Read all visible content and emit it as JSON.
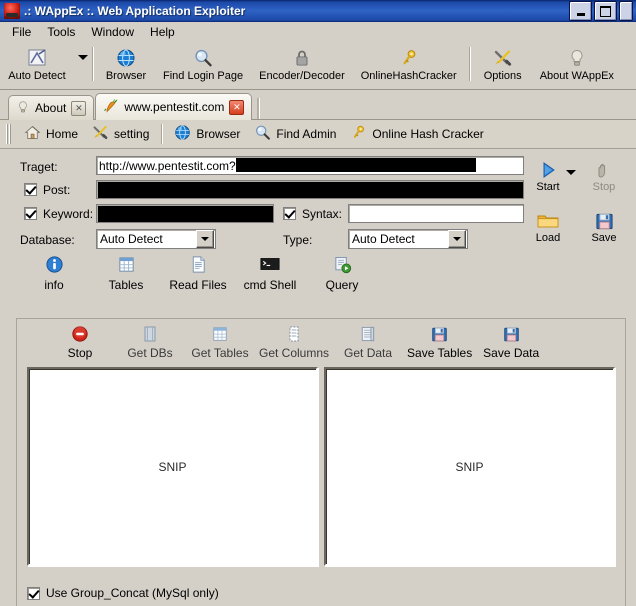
{
  "window": {
    "title": ".: WAppEx :.  Web Application Exploiter",
    "minimize_label": "_",
    "maximize_label": "",
    "close_label": ""
  },
  "menubar": {
    "items": [
      {
        "label": "File"
      },
      {
        "label": "Tools"
      },
      {
        "label": "Window"
      },
      {
        "label": "Help"
      }
    ]
  },
  "toolbar": {
    "items": [
      {
        "label": "Auto Detect",
        "icon": "auto-detect-icon",
        "has_dropdown": true
      },
      {
        "label": "Browser",
        "icon": "globe-icon"
      },
      {
        "label": "Find Login Page",
        "icon": "magnifier-icon"
      },
      {
        "label": "Encoder/Decoder",
        "icon": "padlock-icon"
      },
      {
        "label": "OnlineHashCracker",
        "icon": "key-icon"
      },
      {
        "label": "Options",
        "icon": "tools-icon"
      },
      {
        "label": "About WAppEx",
        "icon": "lightbulb-icon"
      }
    ]
  },
  "tabs": [
    {
      "label": "About",
      "icon": "lightbulb-icon",
      "close_label": "✕",
      "active": false
    },
    {
      "label": "www.pentestit.com",
      "icon": "carrot-icon",
      "close_label": "✕",
      "active": true
    }
  ],
  "navbar": {
    "items": [
      {
        "label": "Home",
        "icon": "home-icon"
      },
      {
        "label": "setting",
        "icon": "tools-icon"
      },
      {
        "label": "Browser",
        "icon": "globe-icon"
      },
      {
        "label": "Find Admin",
        "icon": "magnifier-icon"
      },
      {
        "label": "Online Hash Cracker",
        "icon": "key-icon"
      }
    ]
  },
  "form": {
    "target_label": "Traget:",
    "target_value": "http://www.pentestit.com?",
    "post_label": "Post:",
    "post_checked": true,
    "post_value": "",
    "keyword_label": "Keyword:",
    "keyword_checked": true,
    "keyword_value": "",
    "syntax_label": "Syntax:",
    "syntax_checked": true,
    "syntax_value": "",
    "database_label": "Database:",
    "database_value": "Auto Detect",
    "type_label": "Type:",
    "type_value": "Auto Detect"
  },
  "actions": {
    "start_label": "Start",
    "stop_label": "Stop",
    "load_label": "Load",
    "save_label": "Save",
    "stop_disabled": true
  },
  "modes": [
    {
      "label": "info",
      "icon": "info-icon"
    },
    {
      "label": "Tables",
      "icon": "table-icon"
    },
    {
      "label": "Read Files",
      "icon": "document-icon"
    },
    {
      "label": "cmd Shell",
      "icon": "console-icon"
    },
    {
      "label": "Query",
      "icon": "query-icon"
    }
  ],
  "inner_toolbar": [
    {
      "label": "Stop",
      "icon": "stop-icon",
      "enabled": true
    },
    {
      "label": "Get DBs",
      "icon": "database-icon",
      "enabled": false
    },
    {
      "label": "Get Tables",
      "icon": "table-icon",
      "enabled": false
    },
    {
      "label": "Get Columns",
      "icon": "columns-icon",
      "enabled": false
    },
    {
      "label": "Get Data",
      "icon": "data-icon",
      "enabled": false
    },
    {
      "label": "Save Tables",
      "icon": "floppy-icon",
      "enabled": true
    },
    {
      "label": "Save Data",
      "icon": "floppy-icon",
      "enabled": true
    }
  ],
  "panels": {
    "left_text": "SNIP",
    "right_text": "SNIP"
  },
  "bottom": {
    "group_concat_label": "Use Group_Concat (MySql only)",
    "group_concat_checked": true
  },
  "colors": {
    "title_start": "#0a246a",
    "title_end": "#2f63c4",
    "face": "#d4d0c8",
    "redaction": "#000000",
    "stop_red": "#c8241a",
    "save_blue": "#2f6fb5"
  }
}
